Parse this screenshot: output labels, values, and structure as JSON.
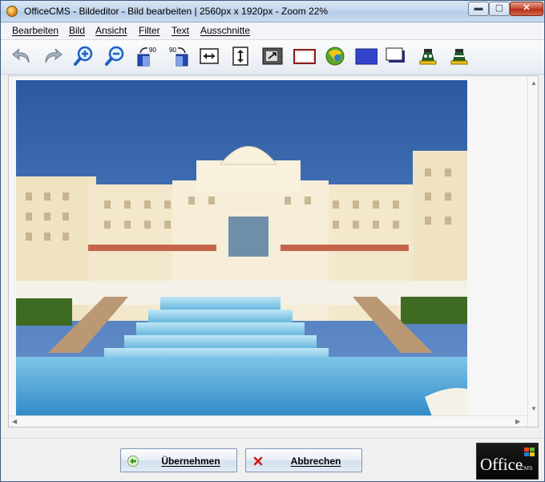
{
  "window": {
    "title": "OfficeCMS - Bildeditor - Bild bearbeiten | 2560px x 1920px - Zoom 22%",
    "controls": {
      "minimize": "▬",
      "maximize": "▢",
      "close": "✕"
    }
  },
  "menu": {
    "items": [
      "Bearbeiten",
      "Bild",
      "Ansicht",
      "Filter",
      "Text",
      "Ausschnitte"
    ]
  },
  "toolbar": {
    "tools": [
      {
        "name": "undo-icon"
      },
      {
        "name": "redo-icon"
      },
      {
        "name": "zoom-in-icon"
      },
      {
        "name": "zoom-out-icon"
      },
      {
        "name": "rotate-left-90-icon",
        "label": "90"
      },
      {
        "name": "rotate-right-90-icon",
        "label": "90"
      },
      {
        "name": "flip-horizontal-icon"
      },
      {
        "name": "flip-vertical-icon"
      },
      {
        "name": "resize-icon"
      },
      {
        "name": "border-frame-icon"
      },
      {
        "name": "color-adjust-icon"
      },
      {
        "name": "fill-color-icon"
      },
      {
        "name": "shadow-frame-icon"
      },
      {
        "name": "filter-add-icon"
      },
      {
        "name": "filter-remove-icon"
      }
    ]
  },
  "colors": {
    "accent_blue": "#1f5fbf",
    "fill_swatch": "#3344cc",
    "window_bg": "#f0f0f0"
  },
  "actions": {
    "apply_label": "Übernehmen",
    "cancel_label": "Abbrechen"
  },
  "logo": {
    "word": "Office",
    "sub": "CMS"
  }
}
